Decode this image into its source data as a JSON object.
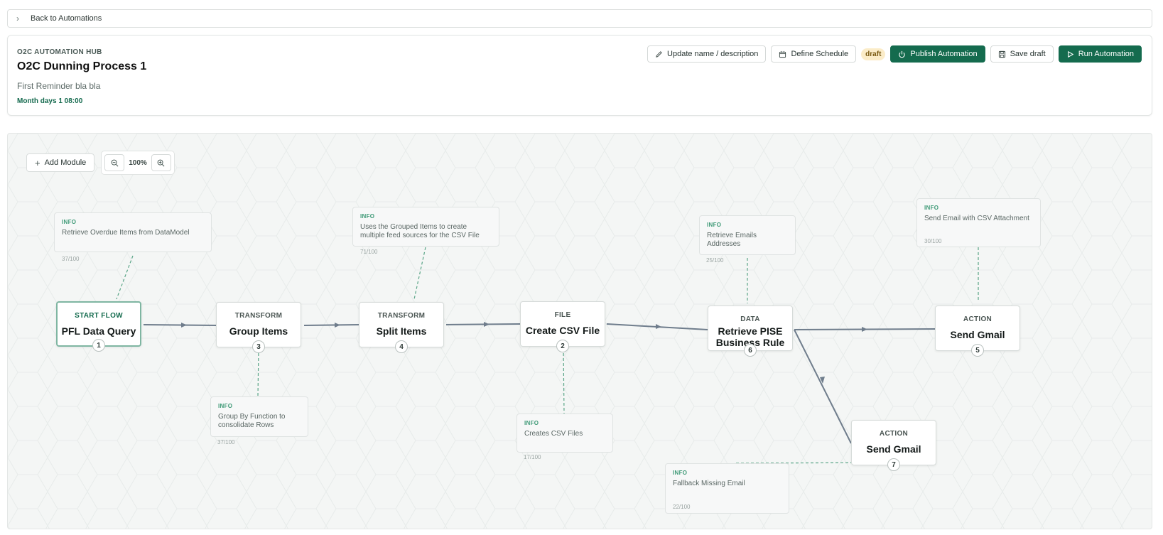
{
  "back_link": {
    "label": "Back to Automations"
  },
  "header": {
    "hub": "O2C AUTOMATION HUB",
    "title": "O2C Dunning Process 1",
    "description": "First Reminder bla bla",
    "schedule": "Month days 1 08:00"
  },
  "toolbar": {
    "update_label": "Update name / description",
    "schedule_label": "Define Schedule",
    "status_badge": "draft",
    "publish_label": "Publish Automation",
    "save_label": "Save draft",
    "run_label": "Run Automation"
  },
  "canvas": {
    "add_module_label": "Add Module",
    "zoom_label": "100%"
  },
  "nodes": [
    {
      "type": "START FLOW",
      "name": "PFL Data Query",
      "number": "1"
    },
    {
      "type": "TRANSFORM",
      "name": "Group Items",
      "number": "3"
    },
    {
      "type": "TRANSFORM",
      "name": "Split Items",
      "number": "4"
    },
    {
      "type": "FILE",
      "name": "Create CSV File",
      "number": "2"
    },
    {
      "type": "DATA",
      "name": "Retrieve PISE Business Rule",
      "number": "6"
    },
    {
      "type": "ACTION",
      "name": "Send Gmail",
      "number": "5"
    },
    {
      "type": "ACTION",
      "name": "Send Gmail",
      "number": "7"
    }
  ],
  "infos": [
    {
      "tag": "INFO",
      "text": "Retrieve Overdue Items from DataModel",
      "count": "37/100"
    },
    {
      "tag": "INFO",
      "text": "Group By Function to consolidate Rows",
      "count": "37/100"
    },
    {
      "tag": "INFO",
      "text": "Uses the Grouped Items to create multiple feed sources for the CSV File",
      "count": "71/100"
    },
    {
      "tag": "INFO",
      "text": "Creates CSV Files",
      "count": "17/100"
    },
    {
      "tag": "INFO",
      "text": "Retrieve Emails Addresses",
      "count": "25/100"
    },
    {
      "tag": "INFO",
      "text": "Send Email with CSV Attachment",
      "count": "30/100"
    },
    {
      "tag": "INFO",
      "text": "Fallback Missing Email",
      "count": "22/100"
    }
  ],
  "colors": {
    "brand": "#146b4e",
    "badge_bg": "#fbecc8",
    "edge": "#6f7d8c",
    "info_link": "#5aa587"
  }
}
